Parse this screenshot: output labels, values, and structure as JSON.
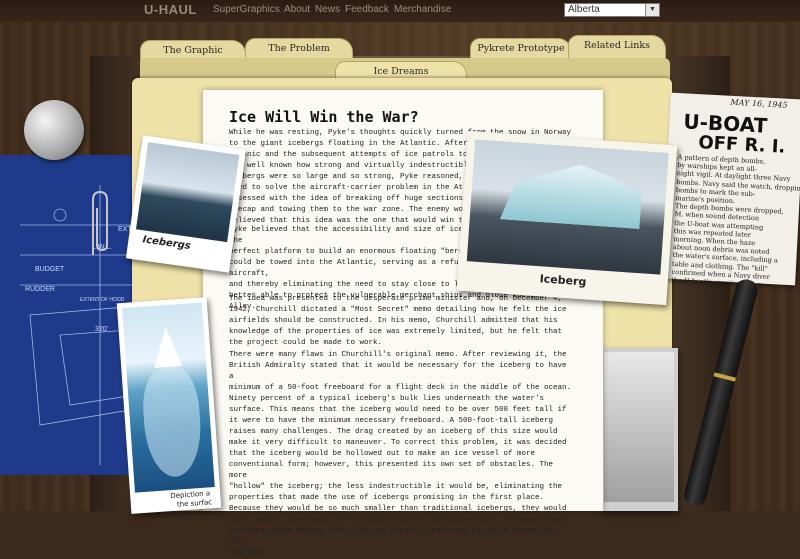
{
  "header": {
    "logo": "U-HAUL",
    "nav": [
      "SuperGraphics",
      "About",
      "News",
      "Feedback",
      "Merchandise"
    ],
    "region_select": "Alberta"
  },
  "tabs": {
    "the_graphic": "The Graphic",
    "the_problem": "The Problem",
    "pykrete_prototype": "Pykrete Prototype",
    "related_links": "Related Links",
    "ice_dreams": "Ice Dreams"
  },
  "article": {
    "title": "Ice Will Win the War?",
    "paragraphs": [
      "While he was resting, Pyke's thoughts quickly turned from the snow in Norway\nto the giant icebergs floating in the Atlantic. After the sinking of the\nTitanic and the subsequent attempts of ice patrols to break up icebergs, it\nwas well known how strong and virtually indestructible they were. Because\nicebergs were so large and so strong, Pyke reasoned, why couldn't they be\nused to solve the aircraft-carrier problem in the Atlantic? Pyke became\nobsessed with the idea of breaking off huge sections of the polar\nicecap and towing them to the war zone. The enemy would never suspect. Pyke\nbelieved that this idea was the one that would win the war.",
      "Pyke believed that the accessibility and size of icebergs would make them the\nperfect platform to build an enormous floating \"bergship.\" A bergship\ncould be towed into the Atlantic, serving as a refueling station for aircraft,\nand thereby eliminating the need to stay close to land. Aircraft would be\nbetter able to protect the vulnerable merchant ships and close the Black Pit\nAlley.",
      "The idea was presented to the desperate prime minister and, on December 4,\n1942, Churchill dictated a \"Most Secret\" memo detailing how he felt the ice\nairfields should be constructed. In his memo, Churchill admitted that his\nknowledge of the properties of ice was extremely limited, but he felt that\nthe project could be made to work.",
      "There were many flaws in Churchill's original memo. After reviewing it, the\nBritish Admiralty stated that it would be necessary for the iceberg to have a\nminimum of a 50-foot freeboard for a flight deck in the middle of the ocean.\nNinety percent of a typical iceberg's bulk lies underneath the water's\nsurface. This means that the iceberg would need to be over 500 feet tall if\nit were to have the minimum necessary freeboard. A 500-foot-tall iceberg\nraises many challenges. The drag created by an iceberg of this size would\nmake it very difficult to maneuver. To correct this problem, it was decided\nthat the iceberg would be hollowed out to make an ice vessel of more\nconventional form; however, this presented its own set of obstacles. The more\n\"hollow\" the iceberg; the less indestructible it would be, eliminating the\nproperties that made the use of icebergs promising in the first place.\nBecause they would be so much smaller than traditional icebergs, they would\nalso require continual refrigeration and an insulating skin. Although these\nproblems stood before them, the ice project continued to build steam into the\nnew year."
    ]
  },
  "photos": {
    "iceberg_caption": "Iceberg",
    "icebergs_left_caption": "Icebergs",
    "depiction_caption_line1": "Depiction a",
    "depiction_caption_line2": "the surfac"
  },
  "newspaper": {
    "date": "MAY 16, 1945",
    "headline_1": "U-BOAT",
    "headline_2": "OFF R. I.",
    "body": "A pattern of depth bombs,\nby warships kept an all-\nnight vigil. At daylight three Navy\nbombs. Navy said the watch, dropping\nbombs to mark the sub-\nmarine's position.\nThe depth bombs were dropped,\nM. when sound detection\nthe U-boat was attempting\nthis was repeated later\nmorning. When the haze\nabout noon debris was noted\nthe water's surface, including a\ntable and clothing. The \"kill\"\nconfirmed when a Navy diver\nthe U-boat's conning tower\nand its side split."
  },
  "blueprint": {
    "labels": [
      "L.W.L.",
      "BUDGET",
      "RUDDER",
      "EXTENT OF HOOD",
      "320'",
      "EXT"
    ]
  },
  "colors": {
    "folder": "#efe2a9",
    "tab": "#e5d8a0",
    "blueprint": "#1f3a8a",
    "paper": "#fbfaf4"
  }
}
